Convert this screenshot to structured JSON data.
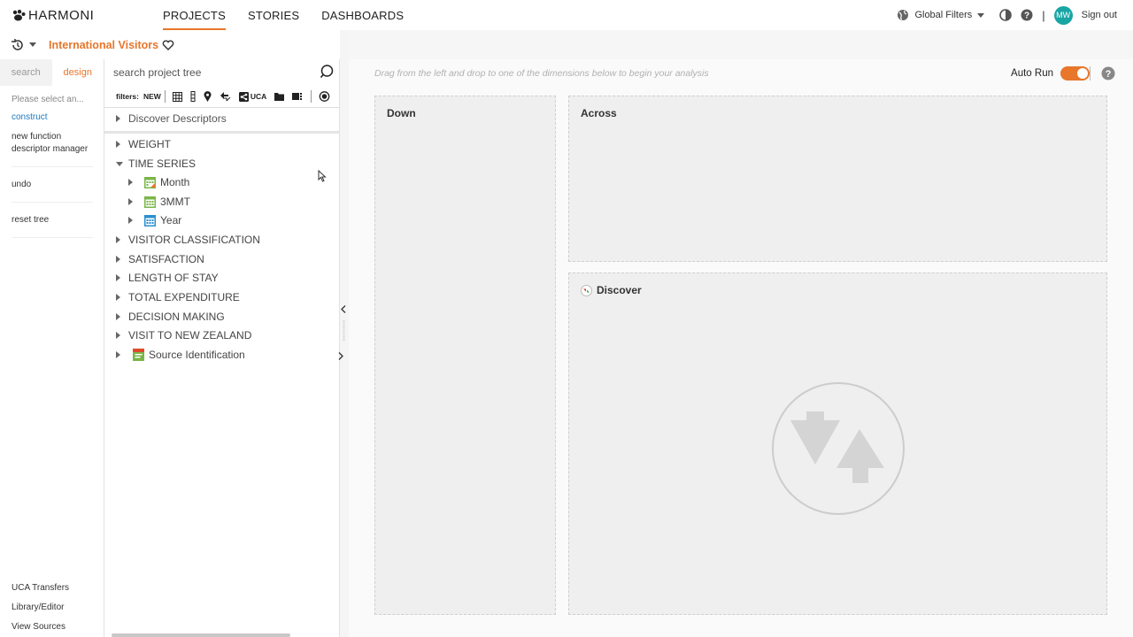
{
  "app": {
    "logo_text": "HARMONI"
  },
  "nav": {
    "items": [
      {
        "label": "PROJECTS",
        "active": true
      },
      {
        "label": "STORIES",
        "active": false
      },
      {
        "label": "DASHBOARDS",
        "active": false
      }
    ]
  },
  "topright": {
    "global_filters": "Global Filters",
    "avatar_initials": "MW",
    "sign_out": "Sign out",
    "separator": "|"
  },
  "project": {
    "title": "International Visitors"
  },
  "left_panel": {
    "tabs": [
      {
        "label": "search"
      },
      {
        "label": "design"
      }
    ],
    "select_prompt": "Please select an...",
    "construct": "construct",
    "new_function": "new function",
    "descriptor_manager": "descriptor manager",
    "undo": "undo",
    "reset_tree": "reset tree",
    "bottom": {
      "uca_transfers": "UCA Transfers",
      "library_editor": "Library/Editor",
      "view_sources": "View Sources"
    }
  },
  "tree_panel": {
    "search_placeholder": "search project tree",
    "filters_label": "filters:",
    "filter_new": "NEW",
    "filter_uca": "UCA",
    "nodes": {
      "discover_descriptors": "Discover Descriptors",
      "weight": "WEIGHT",
      "time_series": "TIME SERIES",
      "month": "Month",
      "mmt": "3MMT",
      "year": "Year",
      "visitor_classification": "VISITOR CLASSIFICATION",
      "satisfaction": "SATISFACTION",
      "length_of_stay": "LENGTH OF STAY",
      "total_expenditure": "TOTAL EXPENDITURE",
      "decision_making": "DECISION MAKING",
      "visit_to_nz": "VISIT TO NEW ZEALAND",
      "source_identification": "Source Identification"
    }
  },
  "main": {
    "hint": "Drag from the left and drop to one of the dimensions below to begin your analysis",
    "auto_run_label": "Auto Run",
    "auto_run_on": true,
    "zones": {
      "down": "Down",
      "across": "Across",
      "discover": "Discover"
    }
  },
  "colors": {
    "accent": "#e8762b",
    "avatar": "#1aa5a5",
    "green_icon": "#7ab648",
    "blue_icon": "#2b8fd0"
  }
}
